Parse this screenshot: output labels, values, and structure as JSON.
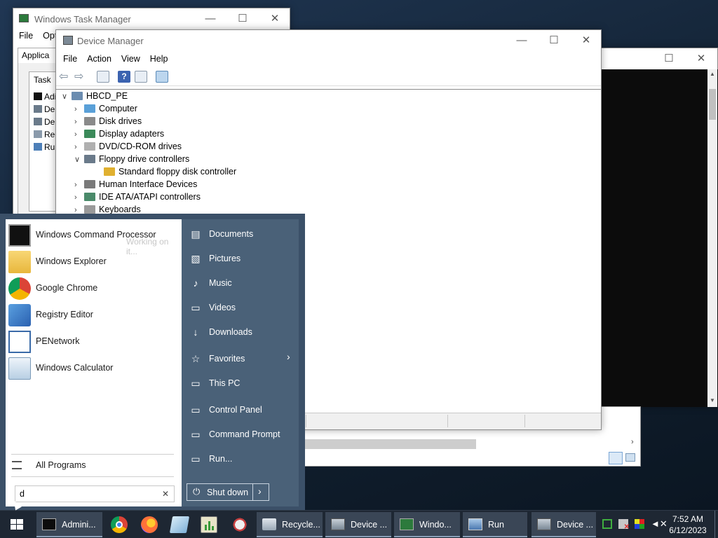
{
  "task_manager": {
    "title": "Windows Task Manager",
    "menu": [
      "File",
      "Opti"
    ],
    "tab_visible": "Applica",
    "list_header": "Task",
    "rows": [
      "Adi",
      "De",
      "De",
      "Rec",
      "Run"
    ]
  },
  "device_manager": {
    "title": "Device Manager",
    "menu": [
      "File",
      "Action",
      "View",
      "Help"
    ],
    "root": "HBCD_PE",
    "tree": [
      {
        "label": "Computer",
        "expanded": false,
        "child": false,
        "icon": "computer-icon"
      },
      {
        "label": "Disk drives",
        "expanded": false,
        "child": false,
        "icon": "disk-drive-icon"
      },
      {
        "label": "Display adapters",
        "expanded": false,
        "child": false,
        "icon": "display-adapter-icon"
      },
      {
        "label": "DVD/CD-ROM drives",
        "expanded": false,
        "child": false,
        "icon": "dvd-drive-icon"
      },
      {
        "label": "Floppy drive controllers",
        "expanded": true,
        "child": false,
        "icon": "floppy-controller-icon"
      },
      {
        "label": "Standard floppy disk controller",
        "expanded": false,
        "child": true,
        "icon": "warning-device-icon"
      },
      {
        "label": "Human Interface Devices",
        "expanded": false,
        "child": false,
        "icon": "hid-icon"
      },
      {
        "label": "IDE ATA/ATAPI controllers",
        "expanded": false,
        "child": false,
        "icon": "ide-controller-icon"
      },
      {
        "label": "Keyboards",
        "expanded": false,
        "child": false,
        "icon": "keyboard-icon"
      }
    ]
  },
  "start_menu": {
    "programs": [
      {
        "label": "Windows Command Processor",
        "icon": "cmd-icon"
      },
      {
        "label": "Windows Explorer",
        "icon": "folder-icon"
      },
      {
        "label": "Google Chrome",
        "icon": "chrome-icon"
      },
      {
        "label": "Registry Editor",
        "icon": "registry-icon"
      },
      {
        "label": "PENetwork",
        "icon": "network-icon"
      },
      {
        "label": "Windows Calculator",
        "icon": "calculator-icon"
      }
    ],
    "ghost_text": "Working on it...",
    "all_programs": "All Programs",
    "search_value": "d",
    "places": [
      {
        "label": "Documents",
        "icon": "documents-icon",
        "glyph": "▤"
      },
      {
        "label": "Pictures",
        "icon": "pictures-icon",
        "glyph": "▧"
      },
      {
        "label": "Music",
        "icon": "music-icon",
        "glyph": "♪"
      },
      {
        "label": "Videos",
        "icon": "videos-icon",
        "glyph": "▭"
      },
      {
        "label": "Downloads",
        "icon": "downloads-icon",
        "glyph": "↓"
      },
      {
        "label": "Favorites",
        "icon": "star-icon",
        "glyph": "☆"
      },
      {
        "label": "This PC",
        "icon": "computer-icon",
        "glyph": "▭"
      },
      {
        "label": "Control Panel",
        "icon": "control-panel-icon",
        "glyph": "▭"
      },
      {
        "label": "Command Prompt",
        "icon": "command-prompt-icon",
        "glyph": "▭"
      },
      {
        "label": "Run...",
        "icon": "run-icon",
        "glyph": "▭"
      }
    ],
    "shutdown": "Shut down"
  },
  "taskbar": {
    "tasks": [
      {
        "label": "Admini...",
        "icon": "cmd-icon"
      },
      {
        "label": "Recycle...",
        "icon": "recycle-bin-icon"
      },
      {
        "label": "Device ...",
        "icon": "device-manager-icon"
      },
      {
        "label": "Windo...",
        "icon": "task-manager-icon"
      },
      {
        "label": "Run",
        "icon": "run-icon"
      },
      {
        "label": "Device ...",
        "icon": "device-manager-icon"
      }
    ],
    "time": "7:52 AM",
    "date": "6/12/2023"
  },
  "colors": {
    "start_panel": "#3b5068",
    "start_places": "#4a6178",
    "taskbar": "#1e2733",
    "task_active": "#3a4656"
  }
}
